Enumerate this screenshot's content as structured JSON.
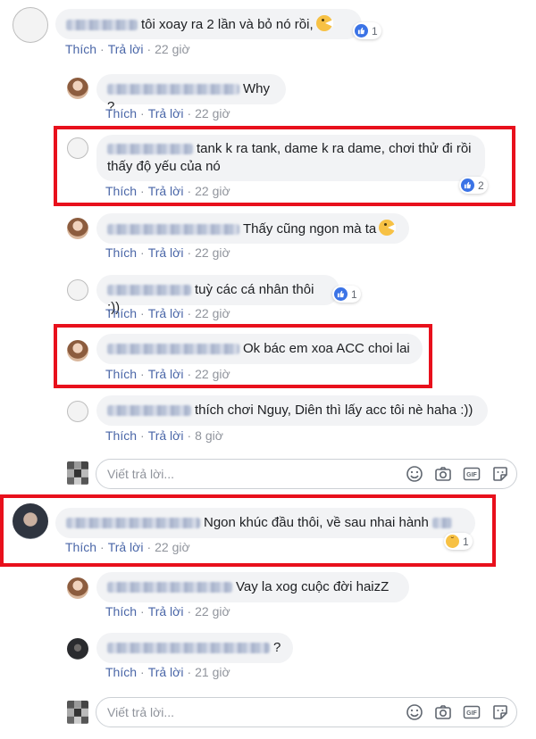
{
  "colors": {
    "link": "#4b67a8",
    "meta": "#90949c",
    "bubble": "#f2f3f5",
    "highlight": "#e8101c",
    "like": "#3b73e6"
  },
  "actions": {
    "like": "Thích",
    "reply": "Trả lời",
    "sep": "·"
  },
  "comments": [
    {
      "text": "tôi xoay ra 2 lần và bỏ nó rồi,",
      "time": "22 giờ",
      "reactions": {
        "type": "like",
        "count": "1"
      },
      "emoji": "pacman-emoji"
    },
    {
      "text": "Why ?",
      "time": "22 giờ"
    },
    {
      "text_line1": "tank k ra tank, dame k ra dame, chơi thử đi rồi",
      "text_line2": "thấy độ yếu của nó",
      "time": "22 giờ",
      "reactions": {
        "type": "like",
        "count": "2"
      }
    },
    {
      "text": "Thấy cũng ngon mà ta",
      "time": "22 giờ",
      "emoji": "pacman-emoji"
    },
    {
      "text": "tuỳ các cá nhân thôi :))",
      "time": "22 giờ",
      "reactions": {
        "type": "like",
        "count": "1"
      }
    },
    {
      "text": "Ok bác em xoa ACC choi lai",
      "time": "22 giờ"
    },
    {
      "text": "thích chơi Nguy, Diên thì lấy acc tôi nè haha :))",
      "time": "8 giờ"
    },
    {
      "text": "Ngon khúc đầu thôi, về sau nhai hành",
      "time": "22 giờ",
      "reactions": {
        "type": "sad",
        "count": "1"
      }
    },
    {
      "text": "Vay la xog cuộc đời haizZ",
      "time": "22 giờ"
    },
    {
      "text": "?",
      "time": "21 giờ"
    }
  ],
  "reply_box": {
    "placeholder": "Viết trả lời..."
  },
  "reply_icons": [
    "emoji-icon",
    "camera-icon",
    "gif-icon",
    "sticker-icon"
  ]
}
